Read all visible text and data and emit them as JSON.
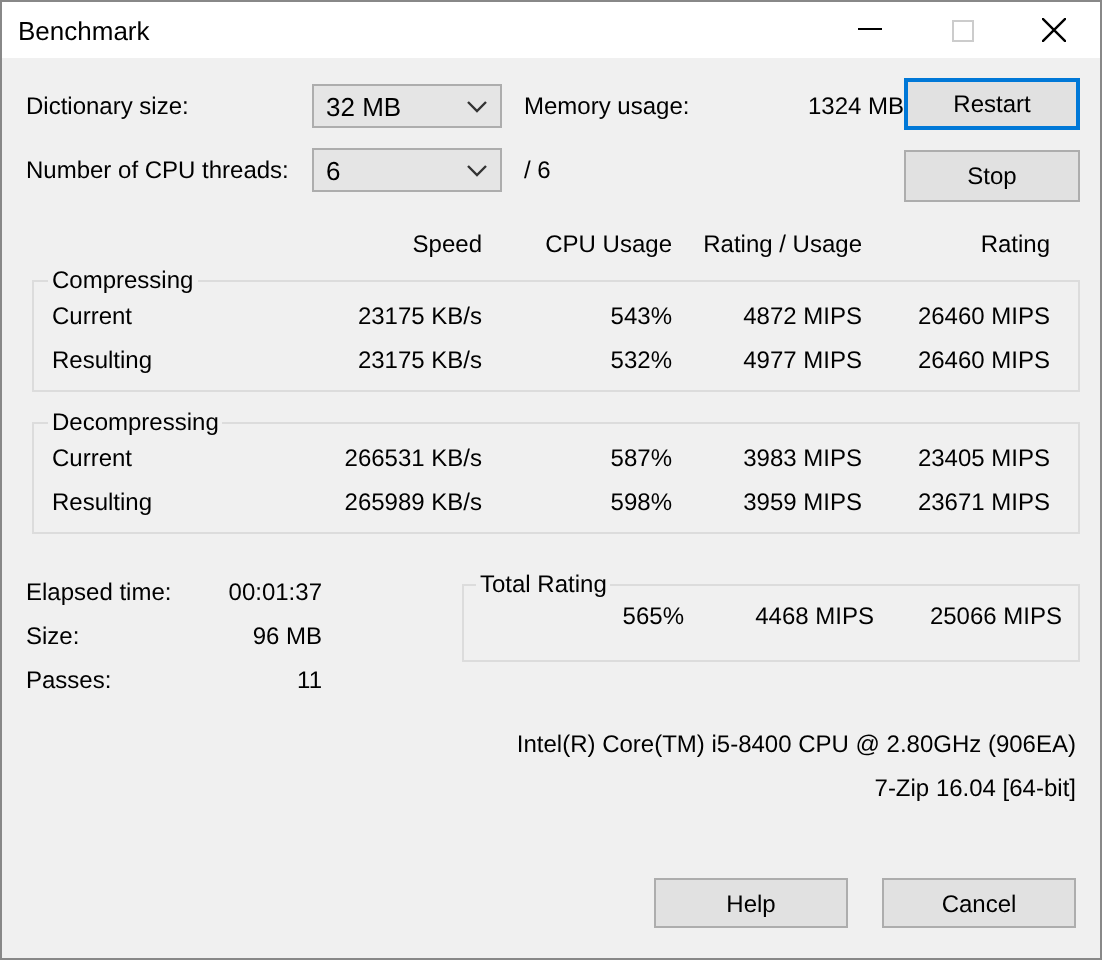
{
  "window": {
    "title": "Benchmark"
  },
  "settings": [
    {
      "label": "Dictionary size:",
      "value": "32 MB",
      "info_label": "Memory usage:",
      "info_value": "1324 MB"
    },
    {
      "label": "Number of CPU threads:",
      "value": "6",
      "info_value": "/ 6"
    }
  ],
  "side_buttons": [
    {
      "label": "Restart",
      "focused": true
    },
    {
      "label": "Stop",
      "focused": false
    }
  ],
  "columns": [
    "Speed",
    "CPU Usage",
    "Rating / Usage",
    "Rating"
  ],
  "sections": [
    {
      "title": "Compressing",
      "rows": [
        {
          "label": "Current",
          "speed": "23175 KB/s",
          "cpu_usage": "543%",
          "rating_per_usage": "4872 MIPS",
          "rating": "26460 MIPS"
        },
        {
          "label": "Resulting",
          "speed": "23175 KB/s",
          "cpu_usage": "532%",
          "rating_per_usage": "4977 MIPS",
          "rating": "26460 MIPS"
        }
      ]
    },
    {
      "title": "Decompressing",
      "rows": [
        {
          "label": "Current",
          "speed": "266531 KB/s",
          "cpu_usage": "587%",
          "rating_per_usage": "3983 MIPS",
          "rating": "23405 MIPS"
        },
        {
          "label": "Resulting",
          "speed": "265989 KB/s",
          "cpu_usage": "598%",
          "rating_per_usage": "3959 MIPS",
          "rating": "23671 MIPS"
        }
      ]
    }
  ],
  "stats": [
    {
      "label": "Elapsed time:",
      "value": "00:01:37"
    },
    {
      "label": "Size:",
      "value": "96 MB"
    },
    {
      "label": "Passes:",
      "value": "11"
    }
  ],
  "total_rating": {
    "title": "Total Rating",
    "cpu_usage": "565%",
    "rating_per_usage": "4468 MIPS",
    "rating": "25066 MIPS"
  },
  "cpu_info": "Intel(R) Core(TM) i5-8400 CPU @ 2.80GHz (906EA)",
  "version": "7-Zip 16.04 [64-bit]",
  "buttons": [
    {
      "label": "Help",
      "focused": false
    },
    {
      "label": "Cancel",
      "focused": false
    }
  ]
}
